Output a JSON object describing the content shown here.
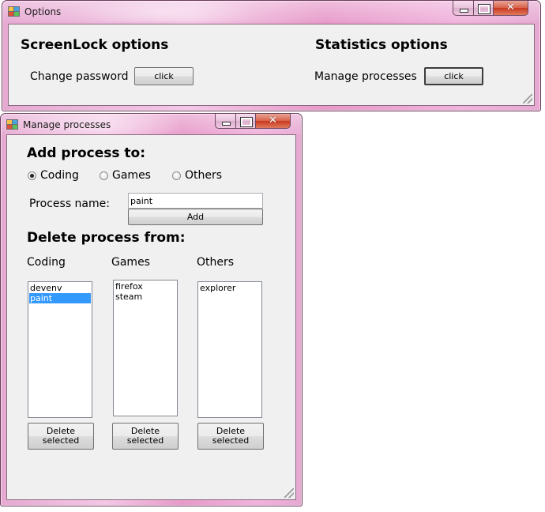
{
  "options_window": {
    "title": "Options",
    "screenlock_heading": "ScreenLock options",
    "change_password_label": "Change password",
    "change_password_button": "click",
    "statistics_heading": "Statistics options",
    "manage_processes_label": "Manage processes",
    "manage_processes_button": "click",
    "close_glyph": "✕"
  },
  "manage_window": {
    "title": "Manage processes",
    "add_heading": "Add process to:",
    "radios": [
      {
        "label": "Coding",
        "checked": true
      },
      {
        "label": "Games",
        "checked": false
      },
      {
        "label": "Others",
        "checked": false
      }
    ],
    "process_name_label": "Process name:",
    "process_name_value": "paint",
    "add_button": "Add",
    "delete_heading": "Delete process from:",
    "lists": [
      {
        "label": "Coding",
        "items": [
          "devenv",
          "paint"
        ],
        "selected": "paint",
        "delete_button": "Delete\nselected"
      },
      {
        "label": "Games",
        "items": [
          "firefox",
          "steam"
        ],
        "selected": null,
        "delete_button": "Delete\nselected"
      },
      {
        "label": "Others",
        "items": [
          "explorer"
        ],
        "selected": null,
        "delete_button": "Delete\nselected"
      }
    ],
    "close_glyph": "✕"
  },
  "colors": {
    "frame_pink": "#f0b3dc",
    "client_gray": "#f0f0f0",
    "selection_blue": "#3399ff",
    "close_red": "#c8381f"
  }
}
